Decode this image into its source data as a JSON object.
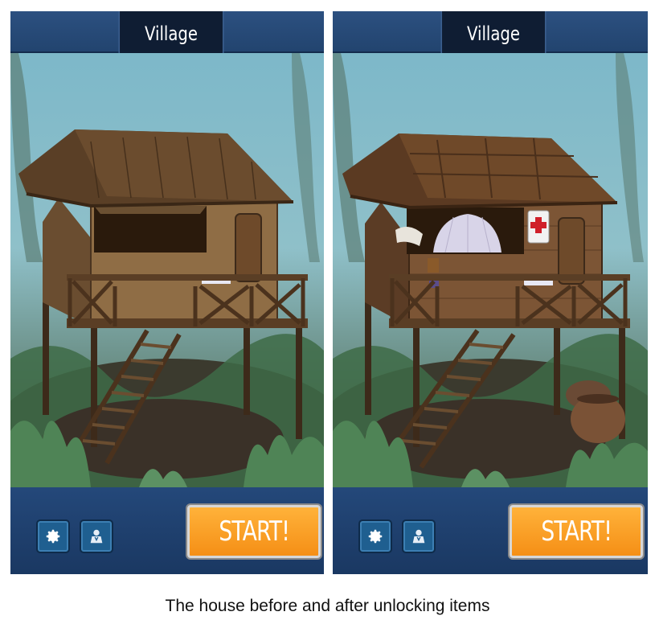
{
  "screens": [
    {
      "id": "before",
      "title": "Village",
      "start_label": "START!",
      "icons": [
        "gear-icon",
        "avatar-icon"
      ],
      "house_state": "thatched hut, empty window"
    },
    {
      "id": "after",
      "title": "Village",
      "start_label": "START!",
      "icons": [
        "gear-icon",
        "avatar-icon"
      ],
      "house_state": "wooden roof, mosquito net, first-aid kit, water pots"
    }
  ],
  "caption": "The house before and after unlocking items",
  "colors": {
    "frame": "#1b3a63",
    "title_tab": "#0f1d33",
    "start_button": "#f7a02a",
    "icon_button": "#1f5f90"
  }
}
